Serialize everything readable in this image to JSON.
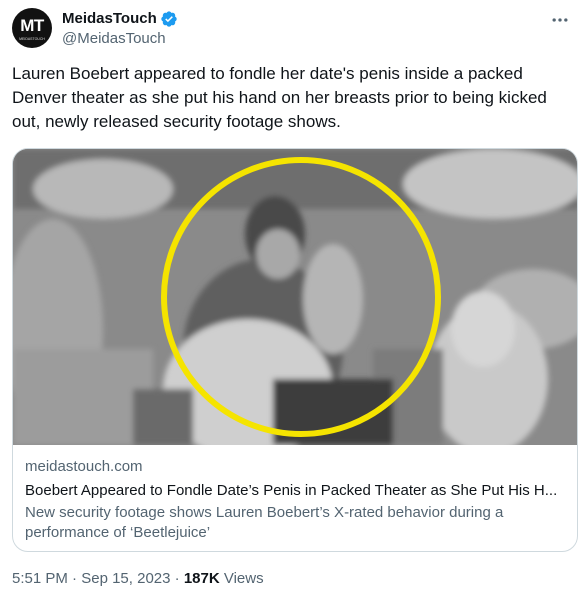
{
  "account": {
    "avatar_text": "MT",
    "avatar_subtext": "MEIDASTOUCH",
    "display_name": "MeidasTouch",
    "handle": "@MeidasTouch",
    "verified_color": "#1d9bf0"
  },
  "tweet": {
    "text": "Lauren Boebert appeared to fondle her date's penis inside a packed Denver theater as she put his hand on her breasts prior to being kicked out, newly released security footage shows."
  },
  "card": {
    "domain": "meidastouch.com",
    "title": "Boebert Appeared to Fondle Date’s Penis in Packed Theater as She Put His H...",
    "description": "New security footage shows Lauren Boebert’s X-rated behavior during a performance of ‘Beetlejuice’",
    "highlight_color": "#f5e400"
  },
  "footer": {
    "time": "5:51 PM",
    "separator": "·",
    "date": "Sep 15, 2023",
    "views_count": "187K",
    "views_label": "Views"
  }
}
